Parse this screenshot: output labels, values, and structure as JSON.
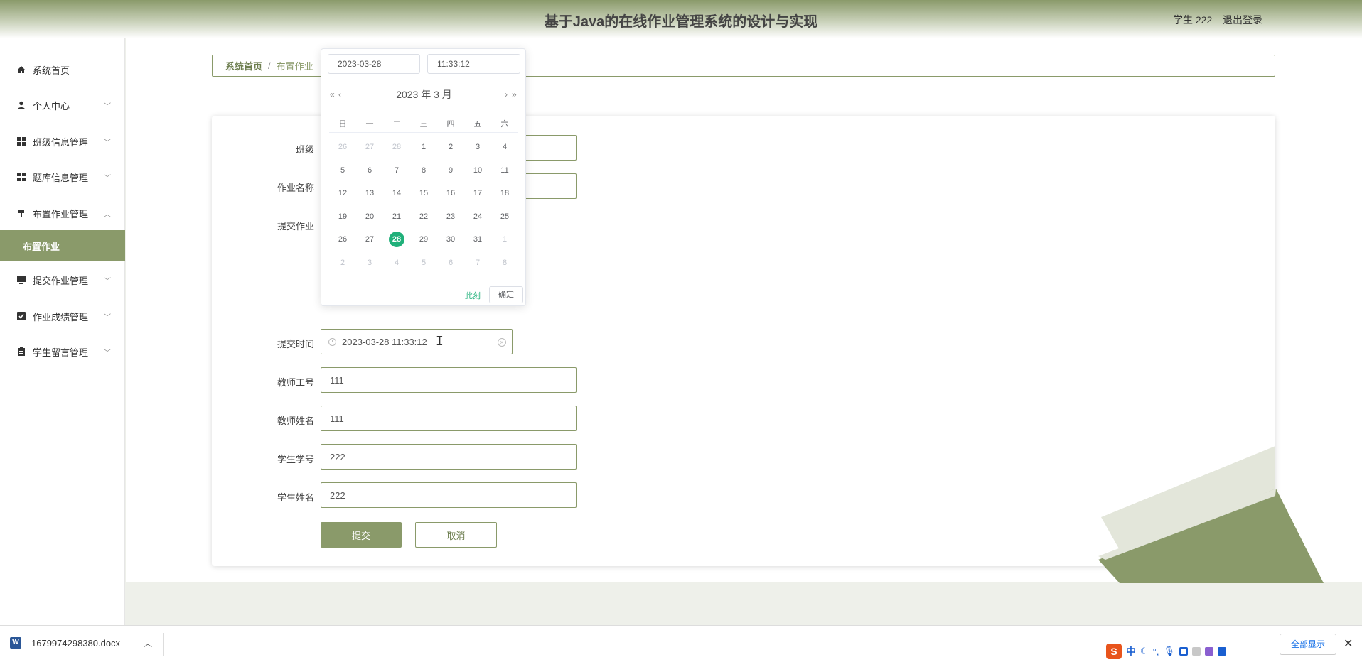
{
  "header": {
    "title": "基于Java的在线作业管理系统的设计与实现",
    "user": "学生 222",
    "logout": "退出登录"
  },
  "sidebar": {
    "items": [
      {
        "label": "系统首页",
        "icon": "home-icon"
      },
      {
        "label": "个人中心",
        "icon": "user-icon"
      },
      {
        "label": "班级信息管理",
        "icon": "grid-icon"
      },
      {
        "label": "题库信息管理",
        "icon": "grid-icon"
      },
      {
        "label": "布置作业管理",
        "icon": "pin-icon"
      },
      {
        "label": "布置作业",
        "icon": ""
      },
      {
        "label": "提交作业管理",
        "icon": "monitor-icon"
      },
      {
        "label": "作业成绩管理",
        "icon": "check-icon"
      },
      {
        "label": "学生留言管理",
        "icon": "clipboard-icon"
      }
    ]
  },
  "breadcrumb": {
    "home": "系统首页",
    "sep": "/",
    "current": "布置作业"
  },
  "form": {
    "class_label": "班级",
    "homework_name_label": "作业名称",
    "submit_homework_label": "提交作业",
    "submit_time_label": "提交时间",
    "submit_time_value": "2023-03-28 11:33:12",
    "teacher_id_label": "教师工号",
    "teacher_id_value": "111",
    "teacher_name_label": "教师姓名",
    "teacher_name_value": "111",
    "student_id_label": "学生学号",
    "student_id_value": "222",
    "student_name_label": "学生姓名",
    "student_name_value": "222",
    "submit_button": "提交",
    "cancel_button": "取消"
  },
  "picker": {
    "date_value": "2023-03-28",
    "time_value": "11:33:12",
    "header": "2023 年  3 月",
    "prev_year": "«",
    "prev_month": "‹",
    "next_month": "›",
    "next_year": "»",
    "weekdays": [
      "日",
      "一",
      "二",
      "三",
      "四",
      "五",
      "六"
    ],
    "weeks": [
      [
        {
          "d": "26",
          "dim": true
        },
        {
          "d": "27",
          "dim": true
        },
        {
          "d": "28",
          "dim": true
        },
        {
          "d": "1"
        },
        {
          "d": "2"
        },
        {
          "d": "3"
        },
        {
          "d": "4"
        }
      ],
      [
        {
          "d": "5"
        },
        {
          "d": "6"
        },
        {
          "d": "7"
        },
        {
          "d": "8"
        },
        {
          "d": "9"
        },
        {
          "d": "10"
        },
        {
          "d": "11"
        }
      ],
      [
        {
          "d": "12"
        },
        {
          "d": "13"
        },
        {
          "d": "14"
        },
        {
          "d": "15"
        },
        {
          "d": "16"
        },
        {
          "d": "17"
        },
        {
          "d": "18"
        }
      ],
      [
        {
          "d": "19"
        },
        {
          "d": "20"
        },
        {
          "d": "21"
        },
        {
          "d": "22"
        },
        {
          "d": "23"
        },
        {
          "d": "24"
        },
        {
          "d": "25"
        }
      ],
      [
        {
          "d": "26"
        },
        {
          "d": "27"
        },
        {
          "d": "28",
          "today": true
        },
        {
          "d": "29"
        },
        {
          "d": "30"
        },
        {
          "d": "31"
        },
        {
          "d": "1",
          "dim": true
        }
      ],
      [
        {
          "d": "2",
          "dim": true
        },
        {
          "d": "3",
          "dim": true
        },
        {
          "d": "4",
          "dim": true
        },
        {
          "d": "5",
          "dim": true
        },
        {
          "d": "6",
          "dim": true
        },
        {
          "d": "7",
          "dim": true
        },
        {
          "d": "8",
          "dim": true
        }
      ]
    ],
    "now_label": "此刻",
    "ok_label": "确定"
  },
  "downloads": {
    "file_name": "1679974298380.docx",
    "show_all": "全部显示"
  },
  "colors": {
    "accent": "#8a9a6a",
    "today": "#20b07a"
  }
}
